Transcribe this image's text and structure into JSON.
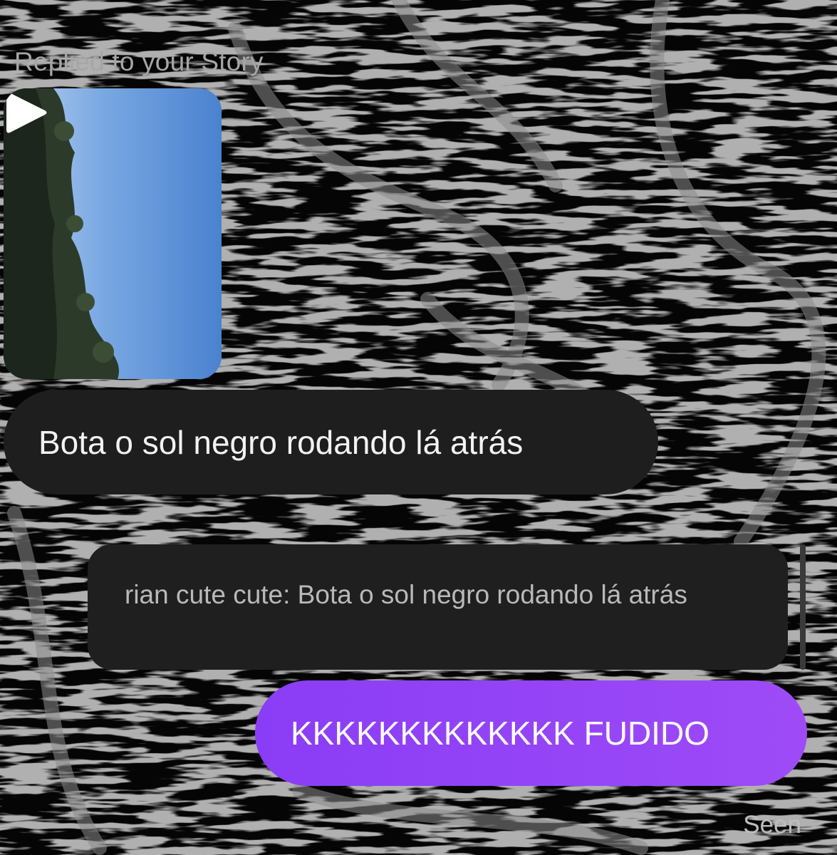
{
  "story": {
    "caption": "Replied to your Story",
    "thumbnail_icon": "play-icon"
  },
  "messages": {
    "incoming_text": "Bota o sol negro rodando lá atrás",
    "reply_preview": "rian cute cute: Bota o sol negro rodando lá atrás",
    "outgoing_text": "KKKKKKKKKKKKK FUDIDO"
  },
  "status": {
    "seen": "Seen"
  },
  "colors": {
    "background": "#050505",
    "incoming_bubble": "#1e1e1e",
    "outgoing_start": "#8a3df6",
    "outgoing_end": "#9e4bf7"
  }
}
